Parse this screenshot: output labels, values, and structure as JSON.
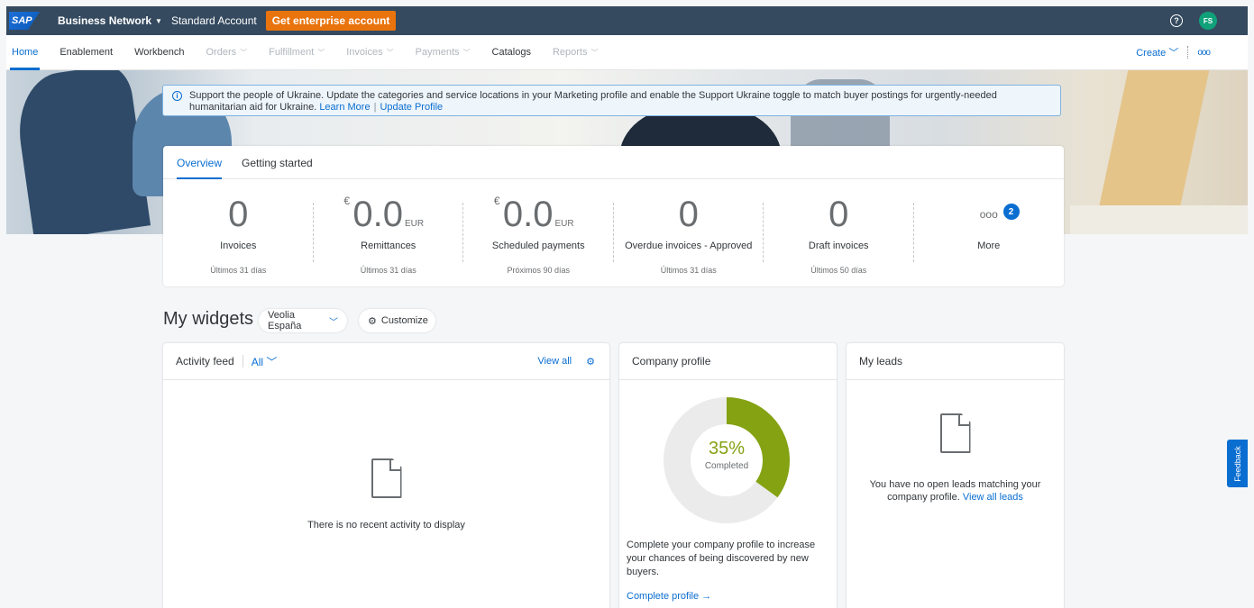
{
  "shell": {
    "logo": "SAP",
    "product": "Business Network",
    "account": "Standard Account",
    "enterprise_button": "Get enterprise account",
    "help_icon": "?",
    "avatar_initials": "FS"
  },
  "nav": {
    "items": [
      {
        "label": "Home",
        "state": "active"
      },
      {
        "label": "Enablement",
        "state": "normal"
      },
      {
        "label": "Workbench",
        "state": "normal"
      },
      {
        "label": "Orders",
        "state": "disabled"
      },
      {
        "label": "Fulfillment",
        "state": "disabled"
      },
      {
        "label": "Invoices",
        "state": "disabled"
      },
      {
        "label": "Payments",
        "state": "disabled"
      },
      {
        "label": "Catalogs",
        "state": "normal"
      },
      {
        "label": "Reports",
        "state": "disabled"
      }
    ],
    "create": "Create",
    "more": "ooo"
  },
  "banner": {
    "text": "Support the people of Ukraine. Update the categories and service locations in your Marketing profile and enable the Support Ukraine toggle to match buyer postings for urgently-needed humanitarian aid for Ukraine.",
    "learn_more": "Learn More",
    "update_profile": "Update Profile"
  },
  "overview": {
    "tabs": [
      "Overview",
      "Getting started"
    ],
    "kpis": [
      {
        "value": "0",
        "label": "Invoices",
        "sub": "Últimos 31 días"
      },
      {
        "currency": "€",
        "value": "0.0",
        "unit": "EUR",
        "label": "Remittances",
        "sub": "Últimos 31 días"
      },
      {
        "currency": "€",
        "value": "0.0",
        "unit": "EUR",
        "label": "Scheduled payments",
        "sub": "Próximos 90 días"
      },
      {
        "value": "0",
        "label": "Overdue invoices - Approved",
        "sub": "Últimos 31 días"
      },
      {
        "value": "0",
        "label": "Draft invoices",
        "sub": "Últimos 50 días"
      }
    ],
    "more": {
      "dots": "ooo",
      "badge": "2",
      "label": "More"
    }
  },
  "widgets": {
    "title": "My widgets",
    "company_filter": "Veolia España",
    "customize": "Customize",
    "activity": {
      "title": "Activity feed",
      "filter": "All",
      "view_all": "View all",
      "empty": "There is no recent activity to display"
    },
    "company_profile": {
      "title": "Company profile",
      "percent": "35%",
      "percent_value": 35,
      "completed_label": "Completed",
      "description": "Complete your company profile to increase your chances of being discovered by new buyers.",
      "link": "Complete profile →",
      "fill_color": "#84a212",
      "track_color": "#ebebeb"
    },
    "leads": {
      "title": "My leads",
      "empty": "You have no open leads matching your company profile.",
      "link": "View all leads"
    }
  },
  "feedback": "Feedback",
  "colors": {
    "accent": "#0a6ed1",
    "shell": "#354a5f",
    "enterprise": "#e9730c"
  }
}
